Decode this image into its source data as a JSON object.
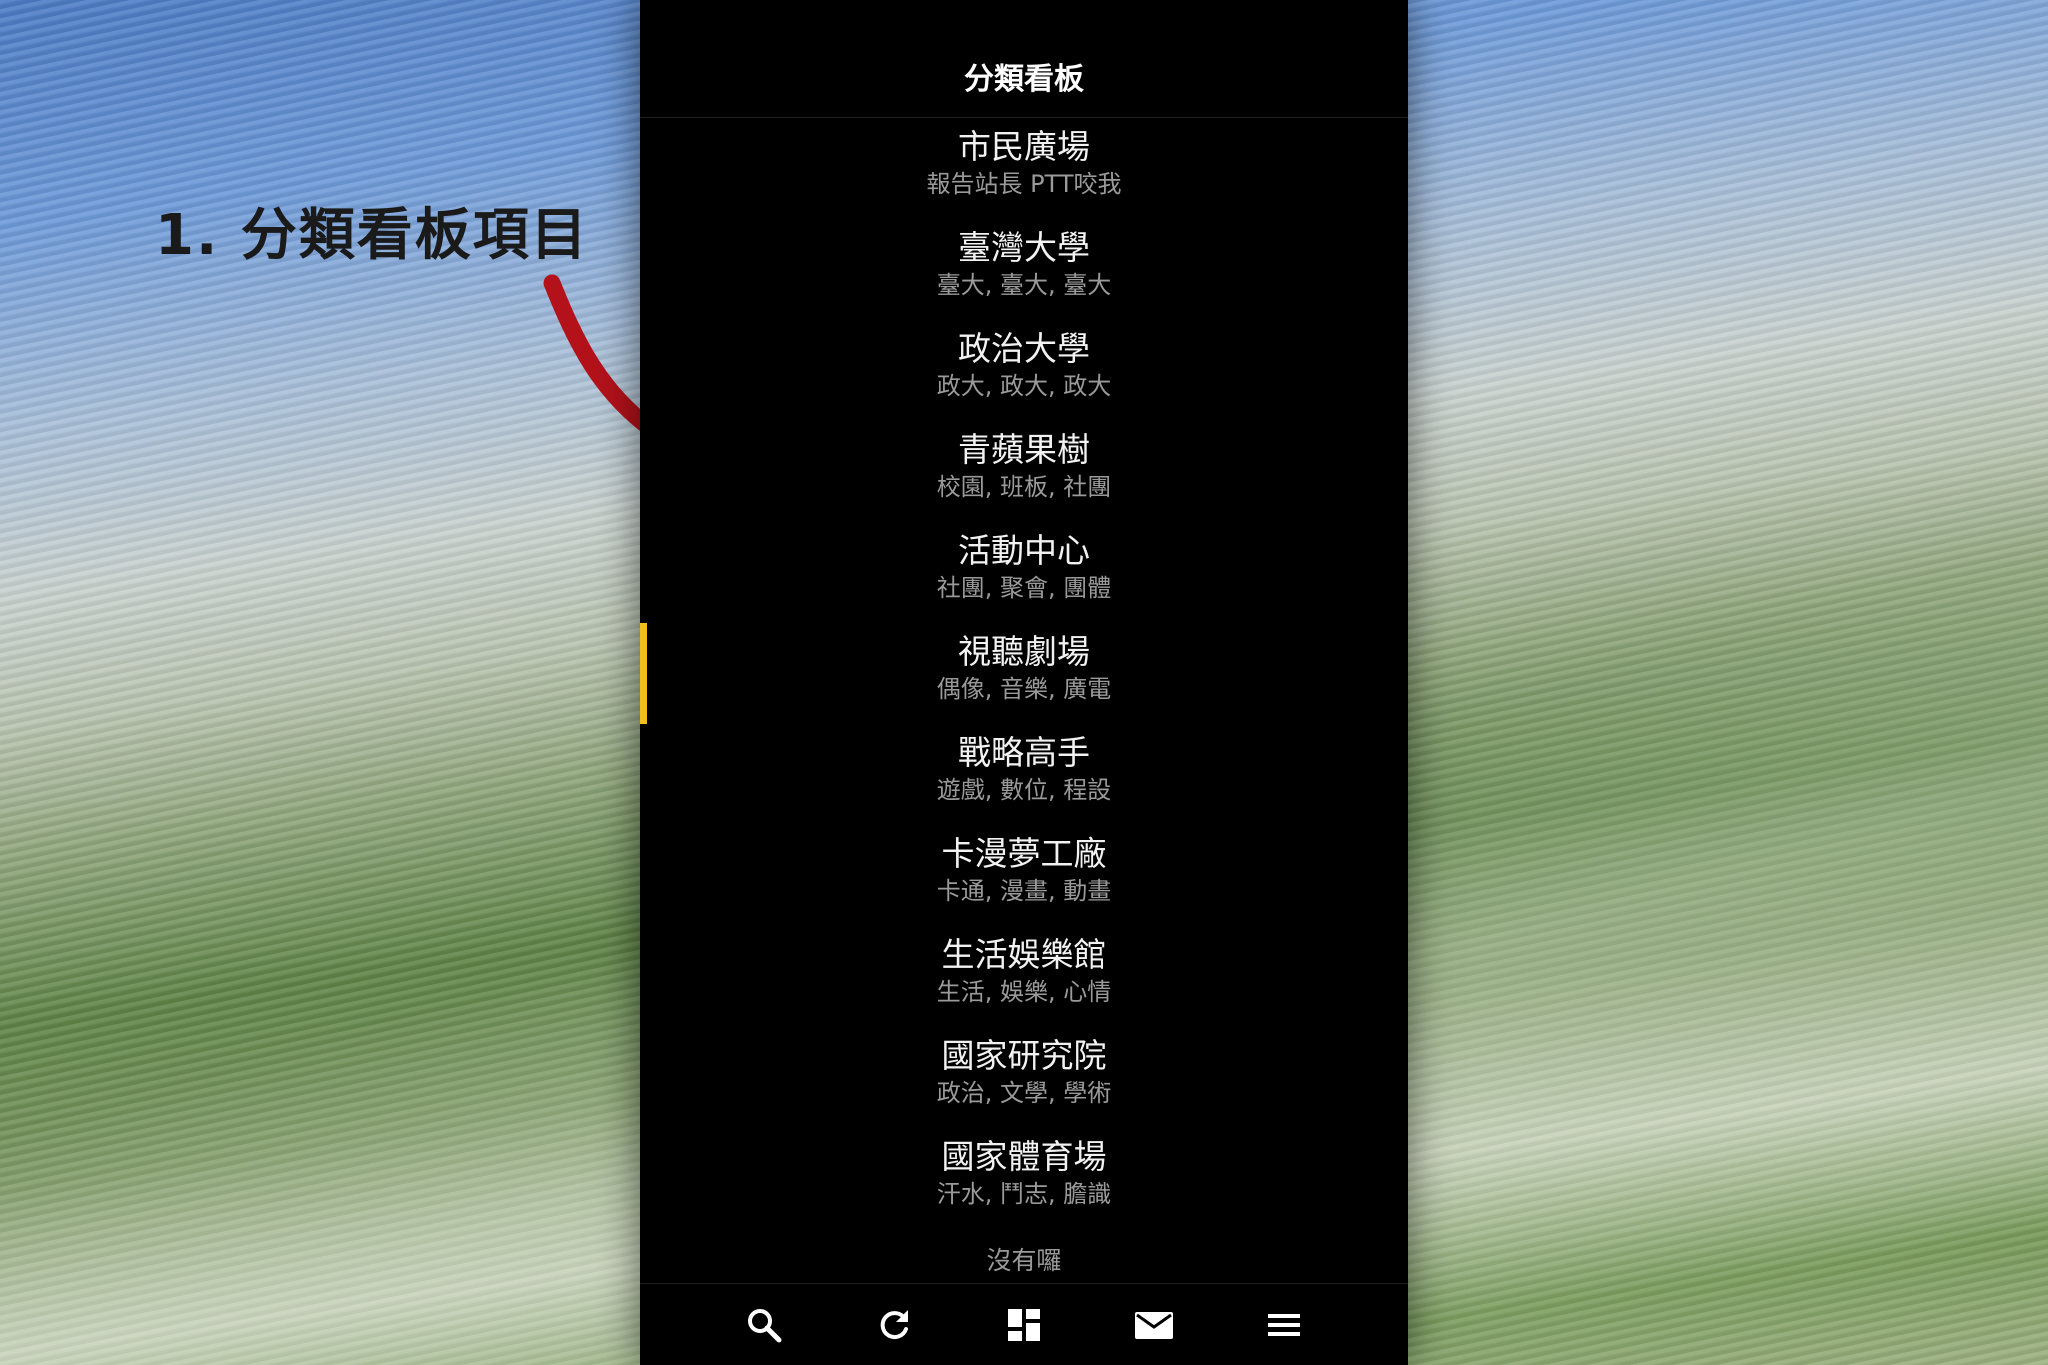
{
  "annotation": {
    "text": "1. 分類看板項目"
  },
  "header": {
    "title": "分類看板"
  },
  "categories": [
    {
      "name": "市民廣場",
      "sub": "報告站長 PTT咬我"
    },
    {
      "name": "臺灣大學",
      "sub": "臺大, 臺大, 臺大"
    },
    {
      "name": "政治大學",
      "sub": "政大, 政大, 政大"
    },
    {
      "name": "青蘋果樹",
      "sub": "校園, 班板, 社團"
    },
    {
      "name": "活動中心",
      "sub": "社團, 聚會, 團體"
    },
    {
      "name": "視聽劇場",
      "sub": "偶像, 音樂, 廣電"
    },
    {
      "name": "戰略高手",
      "sub": "遊戲, 數位, 程設"
    },
    {
      "name": "卡漫夢工廠",
      "sub": "卡通, 漫畫, 動畫"
    },
    {
      "name": "生活娛樂館",
      "sub": "生活, 娛樂, 心情"
    },
    {
      "name": "國家研究院",
      "sub": "政治, 文學, 學術"
    },
    {
      "name": "國家體育場",
      "sub": "汗水, 鬥志, 膽識"
    }
  ],
  "list_footer": "沒有囉",
  "active_index": 5,
  "colors": {
    "accent": "#f5bf1b",
    "background": "#000000",
    "annotation_arrow": "#b3121b"
  },
  "tabs": [
    {
      "icon": "search-icon"
    },
    {
      "icon": "refresh-icon"
    },
    {
      "icon": "board-grid-icon"
    },
    {
      "icon": "mail-icon"
    },
    {
      "icon": "menu-icon"
    }
  ]
}
